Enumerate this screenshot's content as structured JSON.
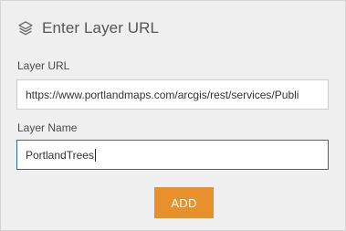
{
  "panel": {
    "title": "Enter Layer URL",
    "title_icon": "layers-icon"
  },
  "form": {
    "url_label": "Layer URL",
    "url_value": "https://www.portlandmaps.com/arcgis/rest/services/Publi",
    "name_label": "Layer Name",
    "name_value": "PortlandTrees"
  },
  "actions": {
    "add_label": "ADD"
  },
  "colors": {
    "panel_background": "#efefef",
    "accent_button": "#e8902c",
    "focused_border": "#2e6aa8"
  }
}
